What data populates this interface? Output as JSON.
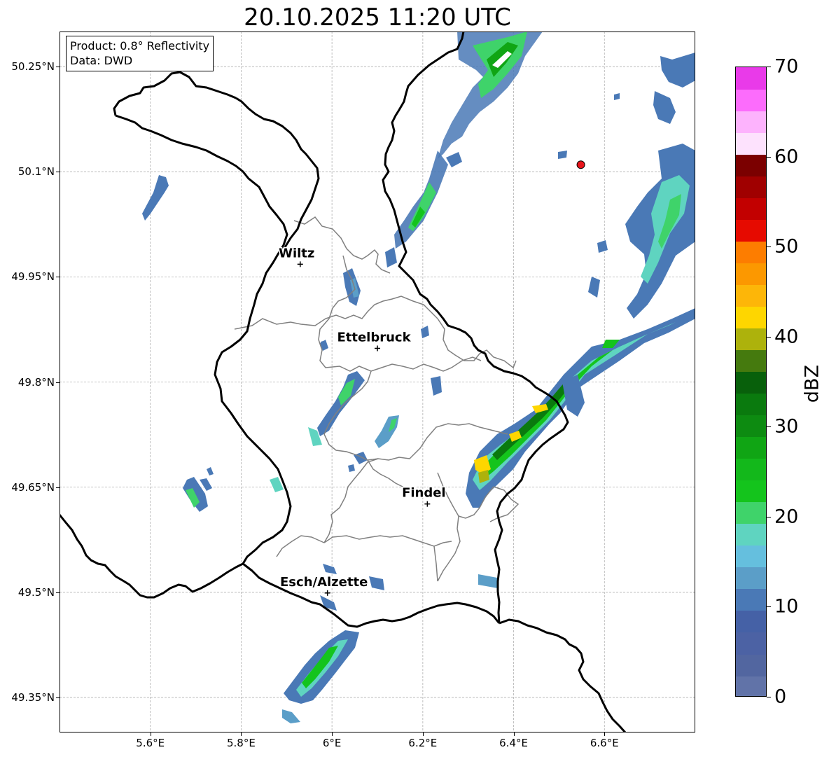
{
  "title": "20.10.2025 11:20 UTC",
  "info": {
    "product": "Product: 0.8° Reflectivity",
    "data": "Data: DWD"
  },
  "lat_ticks": [
    {
      "value": 50.25,
      "label": "50.25°N"
    },
    {
      "value": 50.1,
      "label": "50.1°N"
    },
    {
      "value": 49.95,
      "label": "49.95°N"
    },
    {
      "value": 49.8,
      "label": "49.8°N"
    },
    {
      "value": 49.65,
      "label": "49.65°N"
    },
    {
      "value": 49.5,
      "label": "49.5°N"
    },
    {
      "value": 49.35,
      "label": "49.35°N"
    }
  ],
  "lon_ticks": [
    {
      "value": 5.6,
      "label": "5.6°E"
    },
    {
      "value": 5.8,
      "label": "5.8°E"
    },
    {
      "value": 6.0,
      "label": "6°E"
    },
    {
      "value": 6.2,
      "label": "6.2°E"
    },
    {
      "value": 6.4,
      "label": "6.4°E"
    },
    {
      "value": 6.6,
      "label": "6.6°E"
    }
  ],
  "extent": {
    "lon_min": 5.4,
    "lon_max": 6.8,
    "lat_min": 49.3,
    "lat_max": 50.3
  },
  "cities": [
    {
      "name": "Wiltz",
      "lon": 5.93,
      "lat": 49.968
    },
    {
      "name": "Ettelbruck",
      "lon": 6.1,
      "lat": 49.848
    },
    {
      "name": "Findel",
      "lon": 6.21,
      "lat": 49.626
    },
    {
      "name": "Esch/Alzette",
      "lon": 5.99,
      "lat": 49.499
    }
  ],
  "radar_site": {
    "lon": 6.548,
    "lat": 50.11,
    "color": "#e8141b"
  },
  "colorbar": {
    "label": "dBZ",
    "min": 0,
    "max": 70,
    "ticks": [
      "0",
      "10",
      "20",
      "30",
      "40",
      "50",
      "60",
      "70"
    ],
    "colors": [
      "#6173a8",
      "#5266a0",
      "#4c62a4",
      "#4561a6",
      "#4a79b6",
      "#5b9ec8",
      "#65bfde",
      "#5fd4c0",
      "#3fd36a",
      "#14c41c",
      "#13b81b",
      "#10a514",
      "#0d8b11",
      "#0a7a0e",
      "#08600b",
      "#457a0e",
      "#adb20c",
      "#fed600",
      "#fdb608",
      "#fc9800",
      "#fd7d00",
      "#e60a00",
      "#c20000",
      "#a00000",
      "#7b0000",
      "#fde2fd",
      "#fdb3fd",
      "#fc6cfc",
      "#e93ae9"
    ]
  }
}
